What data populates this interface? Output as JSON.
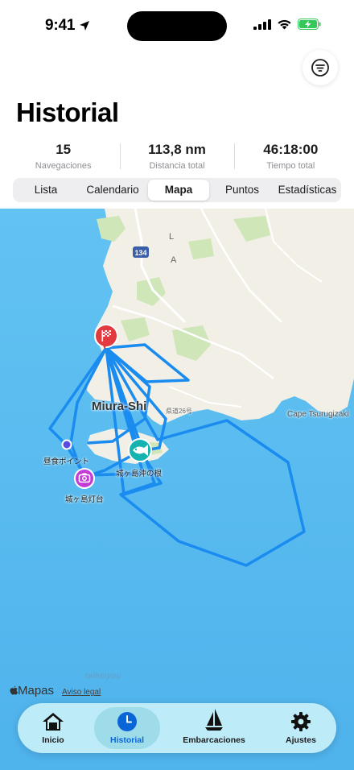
{
  "status_bar": {
    "time": "9:41"
  },
  "header": {
    "title": "Historial"
  },
  "stats": [
    {
      "value": "15",
      "label": "Navegaciones"
    },
    {
      "value": "113,8 nm",
      "label": "Distancia total"
    },
    {
      "value": "46:18:00",
      "label": "Tiempo total"
    }
  ],
  "segments": [
    "Lista",
    "Calendario",
    "Mapa",
    "Puntos",
    "Estadísticas"
  ],
  "selected_segment": "Mapa",
  "map": {
    "city_label": "Miura-Shi",
    "cape_label": "Cape Tsurugizaki",
    "road_label": "県道26号",
    "route_shield": "134",
    "area_letters": [
      "L",
      "A"
    ],
    "poi_lunch": "昼食ポイント",
    "poi_fishing": "城ヶ島沖の根",
    "poi_lighthouse": "城ヶ島灯台",
    "sea_name": "taiheiyou",
    "maps_brand": "Mapas",
    "legal_link": "Aviso legal",
    "route_color": "#1a8cf0",
    "sea_color": "#5bbcf0"
  },
  "tabs": [
    {
      "label": "Inicio",
      "icon": "home-icon"
    },
    {
      "label": "Historial",
      "icon": "clock-icon"
    },
    {
      "label": "Embarcaciones",
      "icon": "sailboat-icon"
    },
    {
      "label": "Ajustes",
      "icon": "gear-icon"
    }
  ],
  "active_tab": "Historial"
}
